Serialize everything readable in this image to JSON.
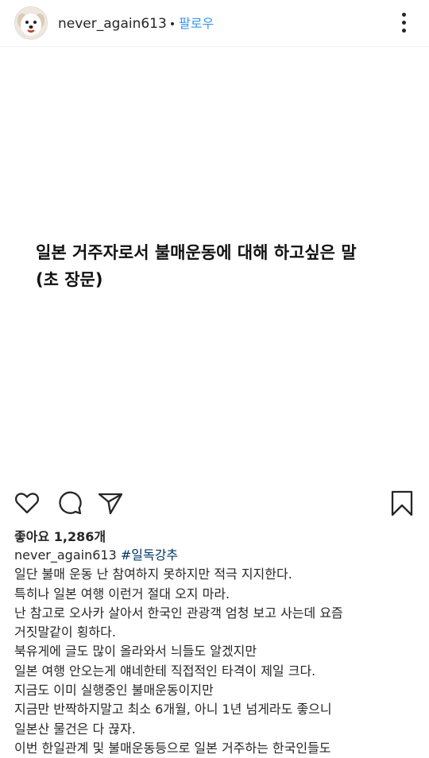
{
  "header": {
    "username": "never_again613",
    "separator": "•",
    "follow_label": "팔로우",
    "avatar_icon": "dog-avatar",
    "more_icon": "more-vertical-icon"
  },
  "post": {
    "text_line1": "일본 거주자로서 불매운동에 대해 하고싶은 말",
    "text_line2": "(초 장문)"
  },
  "actions": {
    "like_icon": "heart-icon",
    "comment_icon": "comment-icon",
    "share_icon": "send-icon",
    "save_icon": "bookmark-icon"
  },
  "likes": {
    "label": "좋아요 1,286개"
  },
  "caption": {
    "username": "never_again613",
    "hashtag": "#일독강추",
    "lines": [
      "일단 불매 운동 난 참여하지 못하지만 적극 지지한다.",
      "특히나 일본 여행 이런거 절대 오지 마라.",
      "난 참고로 오사카 살아서 한국인 관광객 엄청 보고 사는데 요즘",
      "거짓말같이 횡하다.",
      "북유게에 글도 많이 올라와서 늬들도 알겠지만",
      "일본 여행 안오는게 얘네한테 직접적인 타격이 제일 크다.",
      "지금도 이미 실행중인 불매운동이지만",
      "지금만 반짝하지말고 최소 6개월, 아니 1년 넘게라도 좋으니",
      "일본산 물건은 다 끊자.",
      "이번 한일관계 및 불매운동등으로 일본 거주하는 한국인들도"
    ]
  },
  "colors": {
    "link_blue": "#3897f0",
    "hashtag": "#003569",
    "text": "#262626"
  }
}
